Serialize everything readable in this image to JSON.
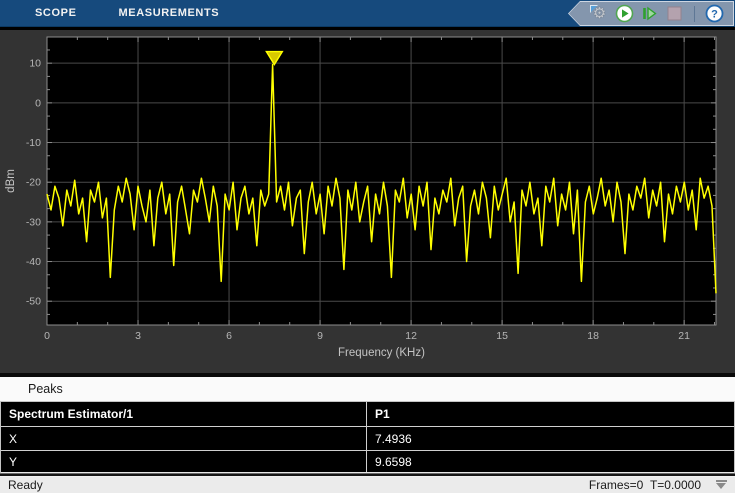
{
  "toolbar": {
    "tabs": [
      {
        "label": "SCOPE"
      },
      {
        "label": "MEASUREMENTS"
      }
    ],
    "gear_glyph": "⚙",
    "help_glyph": "?"
  },
  "colors": {
    "toolbar_blue": "#164a7d",
    "cluster_bg": "#8496ad",
    "panel_bg": "#333333",
    "plot_bg": "#000000",
    "grid": "#4a4a4a",
    "axis_box": "#8c8c8c",
    "tick_text": "#b6b6b6",
    "axis_label_text": "#c4c4c4",
    "trace": "#ffff00",
    "marker_fill": "#d8c800",
    "run_green": "#2fa12f",
    "stop_gray": "#b4a2ae",
    "help_blue": "#2268ae"
  },
  "chart_data": {
    "type": "line",
    "title": "",
    "xlabel": "Frequency (KHz)",
    "ylabel": "dBm",
    "xlim": [
      0,
      22.05
    ],
    "ylim": [
      -56,
      16.6
    ],
    "x_ticks": [
      0,
      3,
      6,
      9,
      12,
      15,
      18,
      21
    ],
    "y_ticks": [
      10,
      0,
      -10,
      -20,
      -30,
      -40,
      -50
    ],
    "grid": true,
    "legend": false,
    "peak_marker": {
      "x": 7.4936,
      "y": 9.6598
    },
    "series": [
      {
        "name": "Spectrum Estimator/1",
        "color": "#ffff00",
        "y_values": [
          -23,
          -27,
          -21,
          -24,
          -31,
          -22,
          -26,
          -19.5,
          -28,
          -24,
          -35,
          -22,
          -25,
          -20,
          -29,
          -24,
          -44,
          -27,
          -21,
          -25,
          -19,
          -23,
          -32,
          -21,
          -26,
          -30,
          -22,
          -36,
          -24,
          -20,
          -28,
          -23,
          -41,
          -25,
          -21,
          -27,
          -33,
          -22,
          -25,
          -19,
          -24,
          -30,
          -21,
          -26,
          -45,
          -23,
          -27,
          -20,
          -32,
          -24,
          -21,
          -28,
          -24,
          -36,
          -22,
          -26,
          -23,
          9.6598,
          -25,
          -21,
          -27,
          -20,
          -31,
          -24,
          -22,
          -38,
          -25,
          -20,
          -28,
          -23,
          -33,
          -21,
          -26,
          -19,
          -24,
          -42,
          -22,
          -27,
          -20,
          -30,
          -25,
          -21,
          -35,
          -23,
          -28,
          -20,
          -26,
          -44,
          -22,
          -25,
          -19,
          -29,
          -23,
          -32,
          -21,
          -26,
          -20,
          -37,
          -24,
          -28,
          -22,
          -25,
          -19,
          -31,
          -24,
          -21,
          -40,
          -26,
          -22,
          -28,
          -20,
          -24,
          -34,
          -21,
          -27,
          -23,
          -19,
          -30,
          -25,
          -43,
          -22,
          -26,
          -20,
          -28,
          -24,
          -36,
          -21,
          -25,
          -19,
          -31,
          -23,
          -27,
          -20,
          -33,
          -22,
          -45,
          -25,
          -21,
          -28,
          -24,
          -19,
          -26,
          -22,
          -30,
          -20,
          -25,
          -38,
          -23,
          -27,
          -21,
          -24,
          -19,
          -29,
          -22,
          -26,
          -20,
          -35,
          -23,
          -28,
          -21,
          -25,
          -20,
          -27,
          -22,
          -32,
          -19,
          -24,
          -21,
          -26,
          -48
        ]
      }
    ]
  },
  "peaks_panel": {
    "title": "Peaks",
    "table": {
      "header": [
        "Spectrum Estimator/1",
        "P1"
      ],
      "rows": [
        [
          "X",
          "7.4936"
        ],
        [
          "Y",
          "9.6598"
        ]
      ]
    }
  },
  "statusbar": {
    "left": "Ready",
    "frames": "Frames=0",
    "time": "T=0.0000"
  }
}
